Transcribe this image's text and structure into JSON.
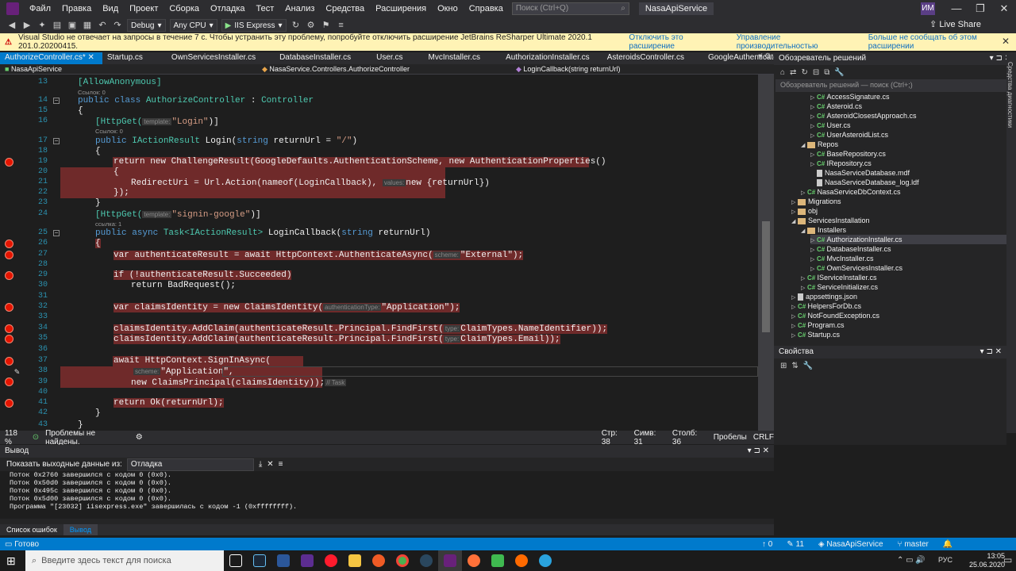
{
  "menu": {
    "items": [
      "Файл",
      "Правка",
      "Вид",
      "Проект",
      "Сборка",
      "Отладка",
      "Тест",
      "Анализ",
      "Средства",
      "Расширения",
      "Окно",
      "Справка"
    ],
    "search_placeholder": "Поиск (Ctrl+Q)",
    "solution_name": "NasaApiService",
    "avatar": "ИМ"
  },
  "toolbar": {
    "config": "Debug",
    "platform": "Any CPU",
    "run_target": "IIS Express",
    "live_share": "Live Share"
  },
  "infobar": {
    "message": "Visual Studio не отвечает на запросы в течение 7 с. Чтобы устранить эту проблему, попробуйте отключить расширение JetBrains ReSharper Ultimate 2020.1 201.0.20200415.",
    "link1": "Отключить это расширение",
    "link2": "Управление производительностью",
    "link3": "Больше не сообщать об этом расширении"
  },
  "tabs": [
    {
      "label": "AuthorizeController.cs*",
      "active": true
    },
    {
      "label": "Startup.cs",
      "active": false
    },
    {
      "label": "OwnServicesInstaller.cs",
      "active": false
    },
    {
      "label": "DatabaseInstaller.cs",
      "active": false
    },
    {
      "label": "User.cs",
      "active": false
    },
    {
      "label": "MvcInstaller.cs",
      "active": false
    },
    {
      "label": "AuthorizationInstaller.cs",
      "active": false
    },
    {
      "label": "AsteroidsController.cs",
      "active": false
    },
    {
      "label": "GoogleAuthenticator.cs",
      "active": false
    }
  ],
  "navbar": {
    "project": "NasaApiService",
    "class": "NasaService.Controllers.AuthorizeController",
    "member": "LoginCallback(string returnUrl)"
  },
  "code": {
    "l13": "[AllowAnonymous]",
    "lens13": "Ссылок: 0",
    "l14a": "public class ",
    "l14b": "AuthorizeController",
    "l14c": " : ",
    "l14d": "Controller",
    "l15": "{",
    "l16a": "[HttpGet(",
    "l16hint": "template:",
    "l16b": "\"Login\"",
    "l16c": ")]",
    "lens16": "Ссылок: 0",
    "l17a": "public ",
    "l17b": "IActionResult",
    "l17c": " Login(",
    "l17d": "string",
    "l17e": " returnUrl = ",
    "l17f": "\"/\"",
    "l17g": ")",
    "l18": "{",
    "l19": "return new ChallengeResult(GoogleDefaults.AuthenticationScheme, new AuthenticationProperties()",
    "l20": "{",
    "l21a": "RedirectUri = Url.Action(nameof(LoginCallback), ",
    "l21hint": "values:",
    "l21b": "new {returnUrl})",
    "l22": "});",
    "l23": "}",
    "l24a": "[HttpGet(",
    "l24hint": "template:",
    "l24b": "\"signin-google\"",
    "l24c": ")]",
    "lens24": "ссылка: 1",
    "l25a": "public async ",
    "l25b": "Task<IActionResult>",
    "l25c": " LoginCallback(",
    "l25d": "string",
    "l25e": " returnUrl)",
    "l26": "{",
    "l27a": "var authenticateResult = await HttpContext.AuthenticateAsync(",
    "l27hint": "scheme:",
    "l27b": "\"External\");",
    "l29": "if (!authenticateResult.Succeeded)",
    "l30": "return BadRequest();",
    "l32a": "var claimsIdentity = new ClaimsIdentity(",
    "l32hint": "authenticationType:",
    "l32b": "\"Application\");",
    "l34a": "claimsIdentity.AddClaim(authenticateResult.Principal.FindFirst(",
    "l34hint": "type:",
    "l34b": "ClaimTypes.NameIdentifier));",
    "l35a": "claimsIdentity.AddClaim(authenticateResult.Principal.FindFirst(",
    "l35hint": "type:",
    "l35b": "ClaimTypes.Email));",
    "l37": "await HttpContext.SignInAsync(",
    "l38hint": "scheme:",
    "l38": "\"Application\",",
    "l39": "new ClaimsPrincipal(claimsIdentity));",
    "l39hint": "// Task",
    "l41": "return Ok(returnUrl);",
    "l42": "}",
    "l43": "}"
  },
  "line_numbers": [
    "13",
    "14",
    "15",
    "16",
    "17",
    "18",
    "19",
    "20",
    "21",
    "22",
    "23",
    "24",
    "25",
    "26",
    "27",
    "28",
    "29",
    "30",
    "31",
    "32",
    "33",
    "34",
    "35",
    "36",
    "37",
    "38",
    "39",
    "40",
    "41",
    "42",
    "43"
  ],
  "editor_status": {
    "zoom": "118 %",
    "problems": "Проблемы не найдены.",
    "line": "Стр: 38",
    "char": "Симв: 31",
    "col": "Столб: 36",
    "spaces": "Пробелы",
    "eol": "CRLF"
  },
  "solution_explorer": {
    "title": "Обозреватель решений",
    "search_placeholder": "Обозреватель решений — поиск (Ctrl+;)",
    "items": [
      {
        "label": "AccessSignature.cs",
        "type": "cs"
      },
      {
        "label": "Asteroid.cs",
        "type": "cs"
      },
      {
        "label": "AsteroidClosestApproach.cs",
        "type": "cs"
      },
      {
        "label": "User.cs",
        "type": "cs"
      },
      {
        "label": "UserAsteroidList.cs",
        "type": "cs"
      },
      {
        "label": "Repos",
        "type": "folder"
      },
      {
        "label": "BaseRepository.cs",
        "type": "cs"
      },
      {
        "label": "IRepository.cs",
        "type": "cs"
      },
      {
        "label": "NasaServiceDatabase.mdf",
        "type": "file"
      },
      {
        "label": "NasaServiceDatabase_log.ldf",
        "type": "file"
      },
      {
        "label": "NasaServiceDbContext.cs",
        "type": "cs"
      },
      {
        "label": "Migrations",
        "type": "folder"
      },
      {
        "label": "obj",
        "type": "folder"
      },
      {
        "label": "ServicesInstallation",
        "type": "folder"
      },
      {
        "label": "Installers",
        "type": "folder"
      },
      {
        "label": "AuthorizationInstaller.cs",
        "type": "cs"
      },
      {
        "label": "DatabaseInstaller.cs",
        "type": "cs"
      },
      {
        "label": "MvcInstaller.cs",
        "type": "cs"
      },
      {
        "label": "OwnServicesInstaller.cs",
        "type": "cs"
      },
      {
        "label": "IServiceInstaller.cs",
        "type": "cs"
      },
      {
        "label": "ServiceInitializer.cs",
        "type": "cs"
      },
      {
        "label": "appsettings.json",
        "type": "file"
      },
      {
        "label": "HelpersForDb.cs",
        "type": "cs"
      },
      {
        "label": "NotFoundException.cs",
        "type": "cs"
      },
      {
        "label": "Program.cs",
        "type": "cs"
      },
      {
        "label": "Startup.cs",
        "type": "cs"
      }
    ],
    "selected": "AuthorizationInstaller.cs"
  },
  "side_strip": "Средства диагностики",
  "properties": {
    "title": "Свойства"
  },
  "output": {
    "title": "Вывод",
    "source_label": "Показать выходные данные из:",
    "source_value": "Отладка",
    "lines": [
      "Поток 0x2760 завершился с кодом 0 (0x0).",
      "Поток 0x50d0 завершился с кодом 0 (0x0).",
      "Поток 0x495c завершился с кодом 0 (0x0).",
      "Поток 0x5d00 завершился с кодом 0 (0x0).",
      "Программа \"[23032] iisexpress.exe\" завершилась с кодом -1 (0xffffffff)."
    ]
  },
  "bottom_tabs": [
    "Список ошибок",
    "Вывод"
  ],
  "bluebar": {
    "status": "Готово",
    "up": "0",
    "edits": "11",
    "repo": "NasaApiService",
    "branch": "master"
  },
  "taskbar": {
    "search_placeholder": "Введите здесь текст для поиска",
    "lang": "РУС",
    "time": "13:05",
    "date": "25.06.2020"
  },
  "colors": {
    "accent": "#007acc",
    "breakpoint": "#e51400",
    "highlight": "#6f2a2a"
  }
}
